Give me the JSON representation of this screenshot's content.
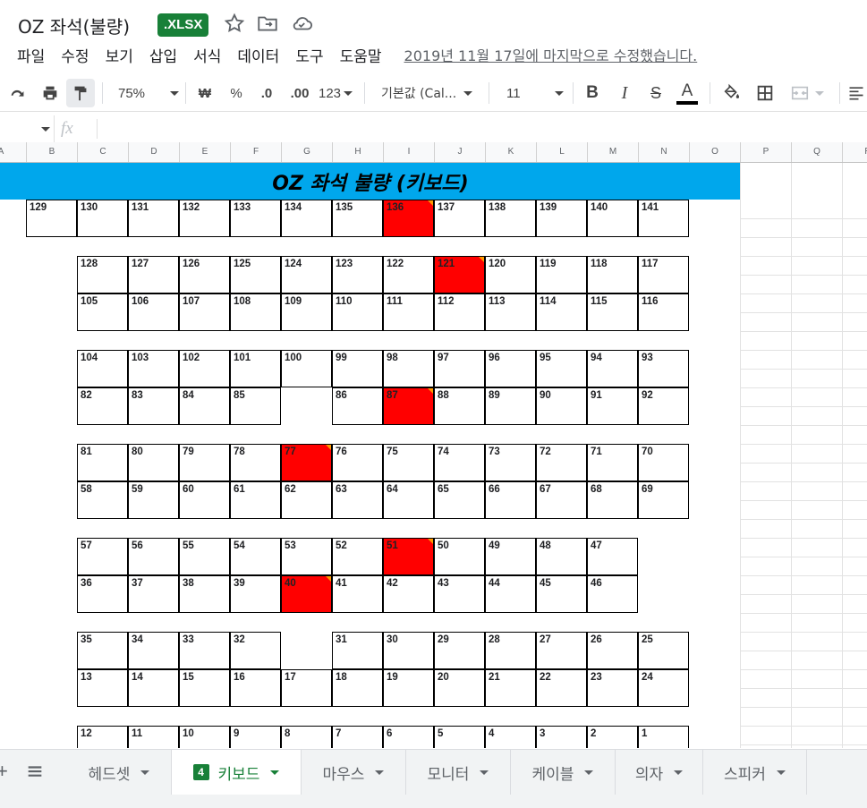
{
  "title_bar": {
    "doc_title": "OZ 좌석(불량)",
    "badge": ".XLSX",
    "icons": [
      "star-icon",
      "move-to-folder-icon",
      "cloud-status-icon"
    ]
  },
  "menu": {
    "items": [
      "파일",
      "수정",
      "보기",
      "삽입",
      "서식",
      "데이터",
      "도구",
      "도움말"
    ],
    "last_edit": "2019년 11월 17일에 마지막으로 수정했습니다."
  },
  "toolbar": {
    "zoom": "75%",
    "currency": "₩",
    "percent": "%",
    "dec_decrease": ".0",
    "dec_increase": ".00",
    "number_format": "123",
    "font": "기본값 (Cal...",
    "font_size": "11",
    "bold": "B",
    "italic": "I",
    "strike": "S",
    "text_color": "A",
    "text_color_value": "#000000"
  },
  "formula_bar": {
    "fx": "fx",
    "value": ""
  },
  "columns": [
    "A",
    "B",
    "C",
    "D",
    "E",
    "F",
    "G",
    "H",
    "I",
    "J",
    "K",
    "L",
    "M",
    "N",
    "O",
    "P",
    "Q",
    "R"
  ],
  "sheet": {
    "banner": "OZ 좌석 불량 (키보드)",
    "banner_color": "#00a7ec",
    "defect_color": "#ff0000",
    "rows": [
      [
        "129",
        "130",
        "131",
        "132",
        "133",
        "134",
        "135",
        "136",
        "137",
        "138",
        "139",
        "140",
        "141"
      ],
      [
        "128",
        "127",
        "126",
        "125",
        "124",
        "123",
        "122",
        "121",
        "120",
        "119",
        "118",
        "117"
      ],
      [
        "105",
        "106",
        "107",
        "108",
        "109",
        "110",
        "111",
        "112",
        "113",
        "114",
        "115",
        "116"
      ],
      [
        "104",
        "103",
        "102",
        "101",
        "100",
        "99",
        "98",
        "97",
        "96",
        "95",
        "94",
        "93"
      ],
      [
        "82",
        "83",
        "84",
        "85",
        "86",
        "87",
        "88",
        "89",
        "90",
        "91",
        "92"
      ],
      [
        "81",
        "80",
        "79",
        "78",
        "77",
        "76",
        "75",
        "74",
        "73",
        "72",
        "71",
        "70"
      ],
      [
        "58",
        "59",
        "60",
        "61",
        "62",
        "63",
        "64",
        "65",
        "66",
        "67",
        "68",
        "69"
      ],
      [
        "57",
        "56",
        "55",
        "54",
        "53",
        "52",
        "51",
        "50",
        "49",
        "48",
        "47"
      ],
      [
        "36",
        "37",
        "38",
        "39",
        "40",
        "41",
        "42",
        "43",
        "44",
        "45",
        "46"
      ],
      [
        "35",
        "34",
        "33",
        "32",
        "31",
        "30",
        "29",
        "28",
        "27",
        "26",
        "25"
      ],
      [
        "13",
        "14",
        "15",
        "16",
        "17",
        "18",
        "19",
        "20",
        "21",
        "22",
        "23",
        "24"
      ],
      [
        "12",
        "11",
        "10",
        "9",
        "8",
        "7",
        "6",
        "5",
        "4",
        "3",
        "2",
        "1"
      ]
    ],
    "defective_seats": [
      "136",
      "121",
      "87",
      "77",
      "51",
      "40"
    ]
  },
  "tabs": {
    "items": [
      "헤드셋",
      "키보드",
      "마우스",
      "모니터",
      "케이블",
      "의자",
      "스피커"
    ],
    "active": "키보드",
    "active_badge": "4"
  }
}
